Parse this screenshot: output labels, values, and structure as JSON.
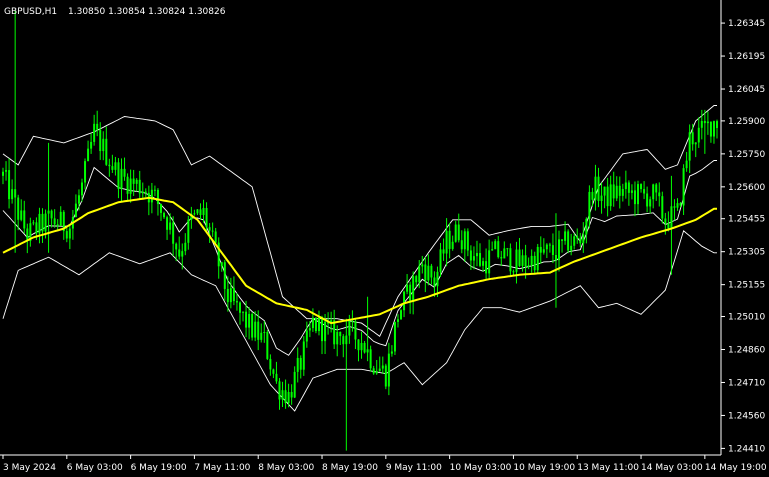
{
  "header": {
    "symbol": "GBPUSD,H1",
    "ohlc": "1.30850 1.30854 1.30824 1.30826"
  },
  "colors": {
    "background": "#000000",
    "axis": "#ffffff",
    "candle": "#00ff00",
    "moving_average": "#ffff00",
    "bands": "#ffffff"
  },
  "chart_data": {
    "type": "candlestick",
    "title": "GBPUSD,H1",
    "ylim": [
      1.2438,
      1.2645
    ],
    "grid": false,
    "y_ticks": [
      "1.26345",
      "1.26195",
      "1.26045",
      "1.25900",
      "1.25750",
      "1.25600",
      "1.25455",
      "1.25305",
      "1.25155",
      "1.25010",
      "1.24860",
      "1.24710",
      "1.24560",
      "1.24410"
    ],
    "x_ticks": [
      "3 May 2024",
      "6 May 03:00",
      "6 May 19:00",
      "7 May 11:00",
      "8 May 03:00",
      "8 May 19:00",
      "9 May 11:00",
      "10 May 03:00",
      "10 May 19:00",
      "13 May 11:00",
      "14 May 03:00",
      "14 May 19:00"
    ],
    "close_anchors": [
      [
        0,
        1.2565
      ],
      [
        3,
        1.2555
      ],
      [
        8,
        1.2538
      ],
      [
        15,
        1.2545
      ],
      [
        22,
        1.2542
      ],
      [
        26,
        1.256
      ],
      [
        30,
        1.2585
      ],
      [
        34,
        1.2575
      ],
      [
        38,
        1.2565
      ],
      [
        42,
        1.2562
      ],
      [
        46,
        1.256
      ],
      [
        50,
        1.2555
      ],
      [
        54,
        1.2545
      ],
      [
        58,
        1.253
      ],
      [
        62,
        1.2545
      ],
      [
        66,
        1.2548
      ],
      [
        70,
        1.253
      ],
      [
        74,
        1.251
      ],
      [
        78,
        1.2502
      ],
      [
        82,
        1.2495
      ],
      [
        86,
        1.249
      ],
      [
        90,
        1.247
      ],
      [
        94,
        1.2465
      ],
      [
        98,
        1.248
      ],
      [
        102,
        1.2498
      ],
      [
        106,
        1.2495
      ],
      [
        110,
        1.2492
      ],
      [
        114,
        1.2494
      ],
      [
        118,
        1.249
      ],
      [
        122,
        1.248
      ],
      [
        126,
        1.2475
      ],
      [
        130,
        1.2502
      ],
      [
        134,
        1.2513
      ],
      [
        138,
        1.2525
      ],
      [
        142,
        1.2517
      ],
      [
        146,
        1.2535
      ],
      [
        150,
        1.254
      ],
      [
        154,
        1.253
      ],
      [
        158,
        1.2525
      ],
      [
        162,
        1.253
      ],
      [
        166,
        1.2528
      ],
      [
        170,
        1.2525
      ],
      [
        174,
        1.2527
      ],
      [
        178,
        1.253
      ],
      [
        182,
        1.253
      ],
      [
        186,
        1.2535
      ],
      [
        190,
        1.2535
      ],
      [
        194,
        1.256
      ],
      [
        198,
        1.2555
      ],
      [
        202,
        1.2558
      ],
      [
        206,
        1.2557
      ],
      [
        210,
        1.2556
      ],
      [
        214,
        1.2556
      ],
      [
        218,
        1.2545
      ],
      [
        222,
        1.2548
      ],
      [
        226,
        1.2582
      ],
      [
        230,
        1.2585
      ],
      [
        234,
        1.259
      ]
    ],
    "ma_anchors": [
      [
        0,
        1.253
      ],
      [
        10,
        1.2537
      ],
      [
        20,
        1.2541
      ],
      [
        28,
        1.2548
      ],
      [
        38,
        1.2553
      ],
      [
        48,
        1.2555
      ],
      [
        56,
        1.2553
      ],
      [
        64,
        1.2545
      ],
      [
        72,
        1.253
      ],
      [
        80,
        1.2515
      ],
      [
        90,
        1.2507
      ],
      [
        100,
        1.2504
      ],
      [
        108,
        1.2498
      ],
      [
        116,
        1.25
      ],
      [
        124,
        1.2502
      ],
      [
        132,
        1.2507
      ],
      [
        140,
        1.251
      ],
      [
        150,
        1.2515
      ],
      [
        160,
        1.2518
      ],
      [
        170,
        1.252
      ],
      [
        180,
        1.2521
      ],
      [
        188,
        1.2526
      ],
      [
        198,
        1.2531
      ],
      [
        210,
        1.2537
      ],
      [
        220,
        1.2541
      ],
      [
        228,
        1.2545
      ],
      [
        234,
        1.255
      ]
    ],
    "upper_band_anchors": [
      [
        0,
        1.2575
      ],
      [
        5,
        1.257
      ],
      [
        10,
        1.2583
      ],
      [
        20,
        1.258
      ],
      [
        30,
        1.2585
      ],
      [
        40,
        1.2592
      ],
      [
        50,
        1.259
      ],
      [
        56,
        1.2586
      ],
      [
        62,
        1.257
      ],
      [
        68,
        1.2574
      ],
      [
        74,
        1.2568
      ],
      [
        82,
        1.256
      ],
      [
        86,
        1.254
      ],
      [
        92,
        1.251
      ],
      [
        100,
        1.25
      ],
      [
        110,
        1.25
      ],
      [
        118,
        1.2498
      ],
      [
        124,
        1.2492
      ],
      [
        130,
        1.251
      ],
      [
        140,
        1.253
      ],
      [
        148,
        1.2545
      ],
      [
        154,
        1.2545
      ],
      [
        160,
        1.2538
      ],
      [
        166,
        1.254
      ],
      [
        174,
        1.2542
      ],
      [
        180,
        1.2542
      ],
      [
        186,
        1.2543
      ],
      [
        190,
        1.2535
      ],
      [
        196,
        1.256
      ],
      [
        204,
        1.2575
      ],
      [
        212,
        1.2577
      ],
      [
        218,
        1.2568
      ],
      [
        222,
        1.257
      ],
      [
        228,
        1.259
      ],
      [
        234,
        1.2597
      ]
    ],
    "lower_band_anchors": [
      [
        0,
        1.25
      ],
      [
        5,
        1.2522
      ],
      [
        15,
        1.2528
      ],
      [
        25,
        1.252
      ],
      [
        35,
        1.253
      ],
      [
        45,
        1.2525
      ],
      [
        55,
        1.253
      ],
      [
        62,
        1.252
      ],
      [
        70,
        1.2515
      ],
      [
        80,
        1.249
      ],
      [
        88,
        1.247
      ],
      [
        96,
        1.2458
      ],
      [
        102,
        1.2473
      ],
      [
        110,
        1.2477
      ],
      [
        118,
        1.2477
      ],
      [
        126,
        1.2475
      ],
      [
        132,
        1.248
      ],
      [
        138,
        1.247
      ],
      [
        146,
        1.248
      ],
      [
        152,
        1.2495
      ],
      [
        158,
        1.2505
      ],
      [
        164,
        1.2505
      ],
      [
        170,
        1.2503
      ],
      [
        180,
        1.2508
      ],
      [
        190,
        1.2515
      ],
      [
        196,
        1.2505
      ],
      [
        202,
        1.2507
      ],
      [
        210,
        1.2502
      ],
      [
        218,
        1.2513
      ],
      [
        224,
        1.254
      ],
      [
        230,
        1.2533
      ],
      [
        234,
        1.253
      ]
    ],
    "spikes": [
      {
        "i": 4,
        "high": 1.264,
        "low": 1.253
      },
      {
        "i": 15,
        "high": 1.258,
        "low": 1.253
      },
      {
        "i": 113,
        "high": 1.25,
        "low": 1.244
      },
      {
        "i": 120,
        "high": 1.251,
        "low": 1.2485
      },
      {
        "i": 182,
        "high": 1.2548,
        "low": 1.2505
      },
      {
        "i": 220,
        "high": 1.2565,
        "low": 1.252
      },
      {
        "i": 231,
        "high": 1.2595,
        "low": 1.2575
      }
    ]
  }
}
